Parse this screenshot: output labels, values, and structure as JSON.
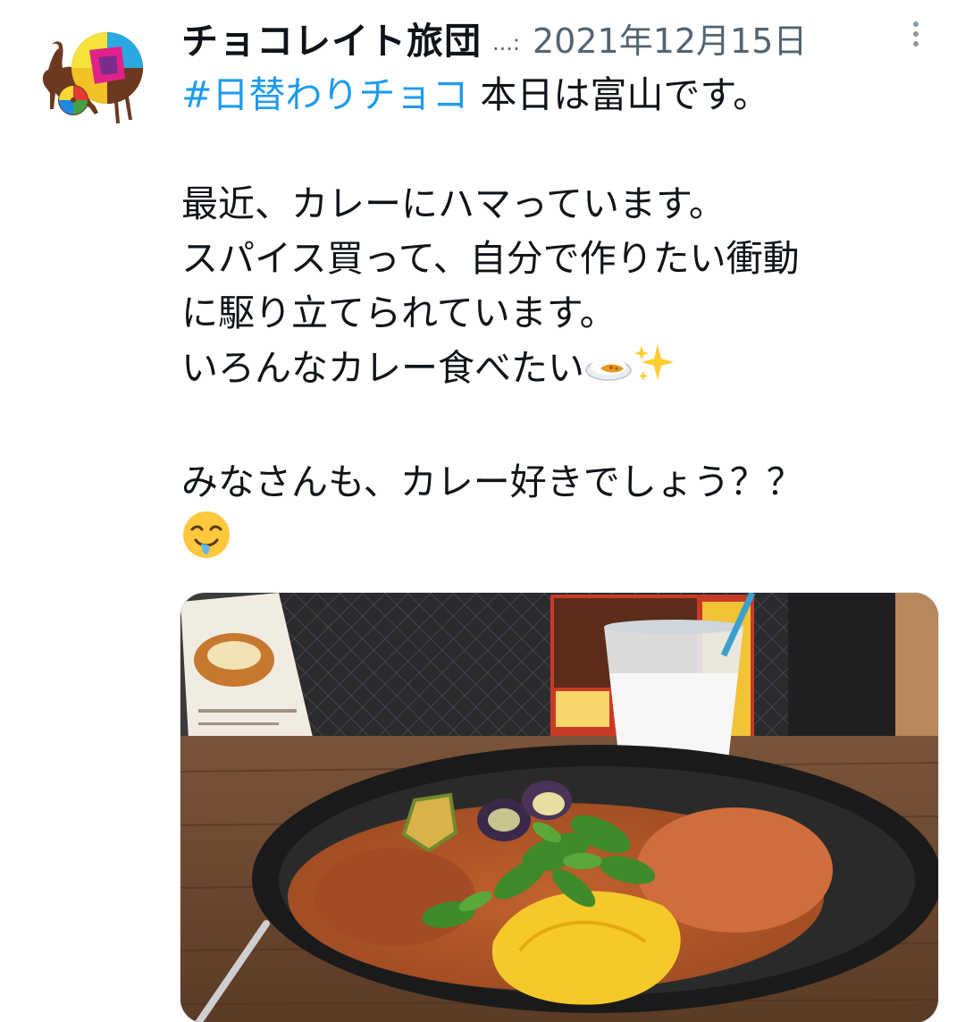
{
  "tweet": {
    "display_name": "チョコレイト旅団",
    "ellipsis": "...:",
    "date": "2021年12月15日",
    "hashtag": "#日替わりチョコ",
    "lines": {
      "line1_rest": " 本日は富山です。",
      "line2": "最近、カレーにハマっています。",
      "line3": "スパイス買って、自分で作りたい衝動",
      "line4": "に駆り立てられています。",
      "line5": "いろんなカレー食べたい",
      "line6": "みなさんも、カレー好きでしょう？？"
    },
    "emoji": {
      "line5": [
        "curry-rice-emoji",
        "sparkles-emoji"
      ],
      "line7": [
        "drooling-face-emoji"
      ]
    },
    "colors": {
      "hashtag": "#1d9bf0",
      "secondary_text": "#536471",
      "primary_text": "#0f1419"
    }
  }
}
